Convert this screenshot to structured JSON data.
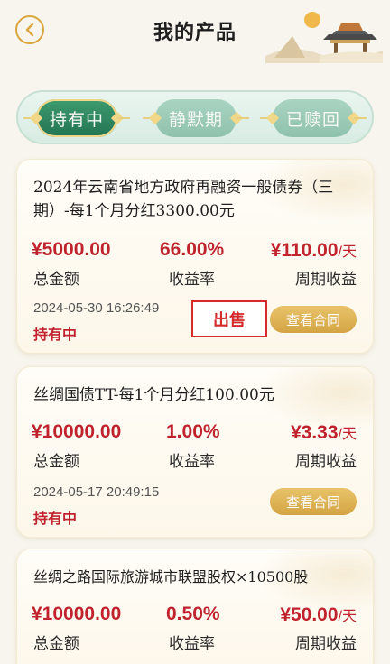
{
  "header": {
    "title": "我的产品",
    "back_icon": "chevron-left-icon",
    "accent": "#d9a640"
  },
  "tabs": [
    {
      "label": "持有中",
      "active": true
    },
    {
      "label": "静默期",
      "active": false
    },
    {
      "label": "已赎回",
      "active": false
    }
  ],
  "labels": {
    "total": "总金额",
    "rate": "收益率",
    "cycle": "周期收益",
    "per_day": "/天",
    "contract": "查看合同",
    "sell": "出售"
  },
  "products": [
    {
      "name": "2024年云南省地方政府再融资一般债券（三期）-每1个月分红3300.00元",
      "amount": "¥5000.00",
      "rate": "66.00%",
      "income": "¥110.00",
      "datetime": "2024-05-30 16:26:49",
      "status": "持有中"
    },
    {
      "name": "丝绸国债TT-每1个月分红100.00元",
      "amount": "¥10000.00",
      "rate": "1.00%",
      "income": "¥3.33",
      "datetime": "2024-05-17 20:49:15",
      "status": "持有中"
    },
    {
      "name": "丝绸之路国际旅游城市联盟股权×10500股",
      "amount": "¥10000.00",
      "rate": "0.50%",
      "income": "¥50.00"
    }
  ],
  "colors": {
    "red": "#c0232e",
    "green": "#237452",
    "gold": "#d4a443"
  }
}
